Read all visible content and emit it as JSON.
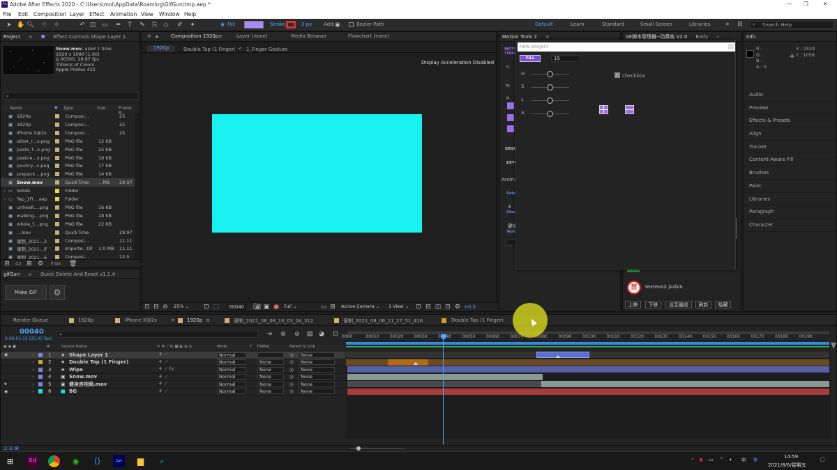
{
  "window": {
    "title": "Adobe After Effects 2020 - C:\\Users\\moi\\AppData\\Roaming\\GifGun\\tmp.aep *",
    "controls": [
      "—",
      "❐",
      "✕"
    ]
  },
  "menu": [
    "File",
    "Edit",
    "Composition",
    "Layer",
    "Effect",
    "Animation",
    "View",
    "Window",
    "Help"
  ],
  "toolbar": {
    "fill_label": "Fill:",
    "stroke_label": "Stroke:",
    "stroke_px": "3 px",
    "add_label": "Add:",
    "bezier_label": "Bezier Path",
    "workspaces": [
      "Default",
      "Learn",
      "Standard",
      "Small Screen",
      "Libraries"
    ],
    "search_placeholder": "Search Help"
  },
  "project": {
    "tab": "Project",
    "tab2": "Effect Controls Shape Layer 1",
    "info": {
      "name": "Snow.mov",
      "used": ", used 1 time",
      "size": "1920 x 1080 (1.00)",
      "dur": "Δ 00300, 29.97 fps",
      "colors": "Trillions of Colors",
      "codec": "Apple ProRes 422"
    },
    "columns": [
      "Name",
      "Type",
      "Size",
      "Frame R..."
    ],
    "items": [
      {
        "name": "1920p",
        "type": "Composi...",
        "size": "",
        "fr": "25",
        "color": "#c9b37a"
      },
      {
        "name": "1920p",
        "type": "Composi...",
        "size": "",
        "fr": "25",
        "color": "#c9b37a"
      },
      {
        "name": "iPhone X@2x",
        "type": "Composi...",
        "size": "",
        "fr": "25",
        "color": "#c9b37a"
      },
      {
        "name": "other_r...x.png",
        "type": "PNG file",
        "size": "12 KB",
        "fr": "",
        "color": "#c9b37a"
      },
      {
        "name": "pasta_f...x.png",
        "type": "PNG file",
        "size": "25 KB",
        "fr": "",
        "color": "#c9b37a"
      },
      {
        "name": "pastrie...x.png",
        "type": "PNG file",
        "size": "18 KB",
        "fr": "",
        "color": "#c9b37a"
      },
      {
        "name": "poultry...x.png",
        "type": "PNG file",
        "size": "17 KB",
        "fr": "",
        "color": "#c9b37a"
      },
      {
        "name": "prepack....png",
        "type": "PNG file",
        "size": "14 KB",
        "fr": "",
        "color": "#c9b37a"
      },
      {
        "name": "Snow.mov",
        "type": "QuickTime",
        "size": "...MB",
        "fr": "29.97",
        "color": "#c9b37a"
      },
      {
        "name": "Solids",
        "type": "Folder",
        "size": "",
        "fr": "",
        "color": "#e6d84a"
      },
      {
        "name": "Tap_1Fi....aep",
        "type": "Folder",
        "size": "",
        "fr": "",
        "color": "#e6d84a"
      },
      {
        "name": "unhealt....png",
        "type": "PNG file",
        "size": "16 KB",
        "fr": "",
        "color": "#c9b37a"
      },
      {
        "name": "walking....png",
        "type": "PNG file",
        "size": "18 KB",
        "fr": "",
        "color": "#c9b37a"
      },
      {
        "name": "whole_f....png",
        "type": "PNG file",
        "size": "22 KB",
        "fr": "",
        "color": "#c9b37a"
      },
      {
        "name": "...mov",
        "type": "QuickTime",
        "size": "",
        "fr": "29.97",
        "color": "#c9b37a"
      },
      {
        "name": "录制_2021...2",
        "type": "Composi...",
        "size": "",
        "fr": "11.11",
        "color": "#c9b37a"
      },
      {
        "name": "录制_2021...if",
        "type": "Importe...till",
        "size": "1.0 MB",
        "fr": "11.11",
        "color": "#c9b37a"
      },
      {
        "name": "录制_2021...6",
        "type": "Composi...",
        "size": "",
        "fr": "12.5",
        "color": "#c9b37a"
      }
    ],
    "bpc": "8 bpc"
  },
  "gifgun": {
    "tab": "gifGun",
    "tab2": "Quick Delete And Reset v1.1.4",
    "make_gif": "Make GIF"
  },
  "comp": {
    "tabs": [
      "Composition 1920p",
      "Layer (none)",
      "Media Browser",
      "Flowchart (none)"
    ],
    "subtabs": [
      "1920p",
      "Double Tap (1 Finger)",
      "1_Finger Gesture"
    ],
    "overlay": "Display Acceleration Disabled",
    "footer": {
      "zoom": "25%",
      "time": "00040",
      "res": "Full",
      "camera": "Active Camera",
      "views": "1 View",
      "exposure": "+0.0"
    }
  },
  "motion_tools": {
    "tab": "Motion Tools 2",
    "logo": "MOTION TOOLS",
    "popup": {
      "placeholder": "new project",
      "fill": "FILL",
      "value": "15",
      "sliders": [
        "H",
        "S",
        "L",
        "A"
      ],
      "checkbox": "checkbox"
    },
    "labels": [
      "SEQUE",
      "EXTRA",
      "Animat",
      "Selec",
      "3",
      "Char",
      "Text",
      "健身"
    ]
  },
  "ae_manager": {
    "tab": "AE脚本管理器--动真格 V2.0",
    "tab2": "Body",
    "item": "textevo2.jsxbin",
    "buttons": [
      "上移",
      "下移",
      "设至最前",
      "刷新",
      "隐藏"
    ]
  },
  "info": {
    "tab": "Info",
    "r": "R :",
    "g": "G :",
    "b": "B :",
    "a": "A : 0",
    "x": "X : 2524",
    "y": "Y : 1056"
  },
  "right_panels": [
    "Audio",
    "Preview",
    "Effects & Presets",
    "Align",
    "Tracker",
    "Content-Aware Fill",
    "Brushes",
    "Paint",
    "Libraries",
    "Paragraph",
    "Character"
  ],
  "timeline": {
    "tabs": [
      "Render Queue",
      "1920p",
      "iPhone X@2x",
      "1920p",
      "录制_2021_08_06_10_03_04_312",
      "录制_2021_08_06_11_27_51_416",
      "Double Tap (1 Finger)"
    ],
    "timecode": "00040",
    "timecode_sub": "0:00:01:15 (25.00 fps)",
    "columns": [
      "#",
      "Source Name",
      "Mode",
      "T",
      "TrkMat",
      "Parent & Link"
    ],
    "ruler": [
      "0000",
      "00010",
      "00020",
      "00030",
      "00040",
      "00050",
      "00060",
      "00070",
      "00080",
      "00090",
      "00100",
      "00110",
      "00120",
      "00130",
      "00140",
      "00150",
      "00160",
      "00170",
      "00180",
      "00190"
    ],
    "layers": [
      {
        "num": "1",
        "name": "Shape Layer 1",
        "mode": "Normal",
        "trk": "",
        "parent": "None",
        "label": "#7a86d9"
      },
      {
        "num": "2",
        "name": "Double Tap (1 Finger)",
        "mode": "Normal",
        "trk": "None",
        "parent": "None",
        "label": "#c9a33c"
      },
      {
        "num": "3",
        "name": "Wipe",
        "mode": "Normal",
        "trk": "None",
        "parent": "None",
        "label": "#7a86d9"
      },
      {
        "num": "4",
        "name": "Snow.mov",
        "mode": "Normal",
        "trk": "None",
        "parent": "None",
        "label": "#7a86d9"
      },
      {
        "num": "5",
        "name": "健身房视频.mov",
        "mode": "Normal",
        "trk": "None",
        "parent": "None",
        "label": "#7a86d9"
      },
      {
        "num": "6",
        "name": "BG",
        "mode": "Normal",
        "trk": "None",
        "parent": "None",
        "label": "#19e4ef"
      }
    ]
  },
  "taskbar": {
    "time": "14:59",
    "date": "2021/8/6/星期五",
    "ime": "中"
  },
  "colors": {
    "canvas": "#19f0f0",
    "fill_swatch": "#a78bfa",
    "stroke_swatch": "#d8332e",
    "accent": "#2d8ceb",
    "playhead": "#4aa3ff"
  }
}
